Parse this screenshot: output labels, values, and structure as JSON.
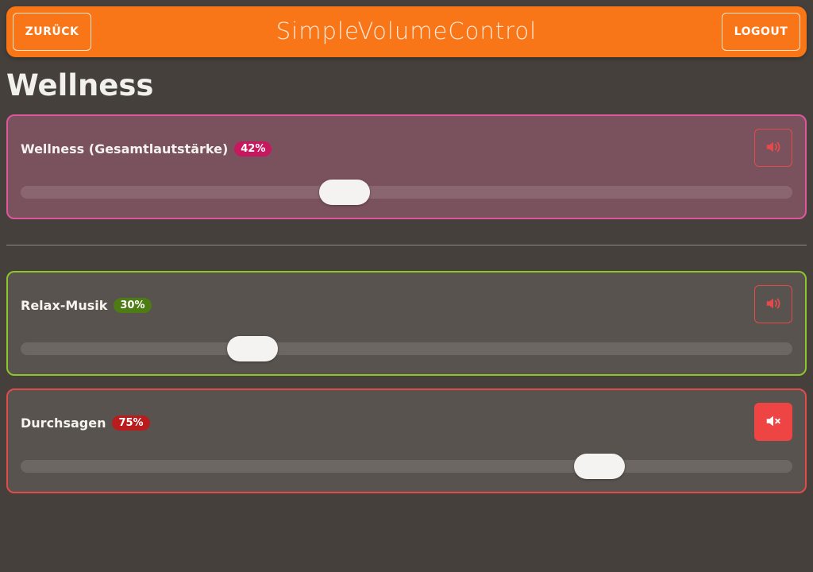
{
  "header": {
    "app_title": "SimpleVolumeControl",
    "back_label": "ZURÜCK",
    "logout_label": "LOGOUT"
  },
  "page": {
    "title": "Wellness"
  },
  "channels": [
    {
      "label": "Wellness (Gesamtlautstärke)",
      "volume": 42,
      "volume_text": "42%",
      "muted": false,
      "accent": "#e0559c",
      "icon": "speaker-icon"
    },
    {
      "label": "Relax-Musik",
      "volume": 30,
      "volume_text": "30%",
      "muted": false,
      "accent": "#8dc62a",
      "icon": "speaker-icon"
    },
    {
      "label": "Durchsagen",
      "volume": 75,
      "volume_text": "75%",
      "muted": true,
      "accent": "#e24b4b",
      "icon": "speaker-muted-icon"
    }
  ],
  "colors": {
    "background": "#45403b",
    "header": "#f97618",
    "mute_active": "#ef4444"
  }
}
